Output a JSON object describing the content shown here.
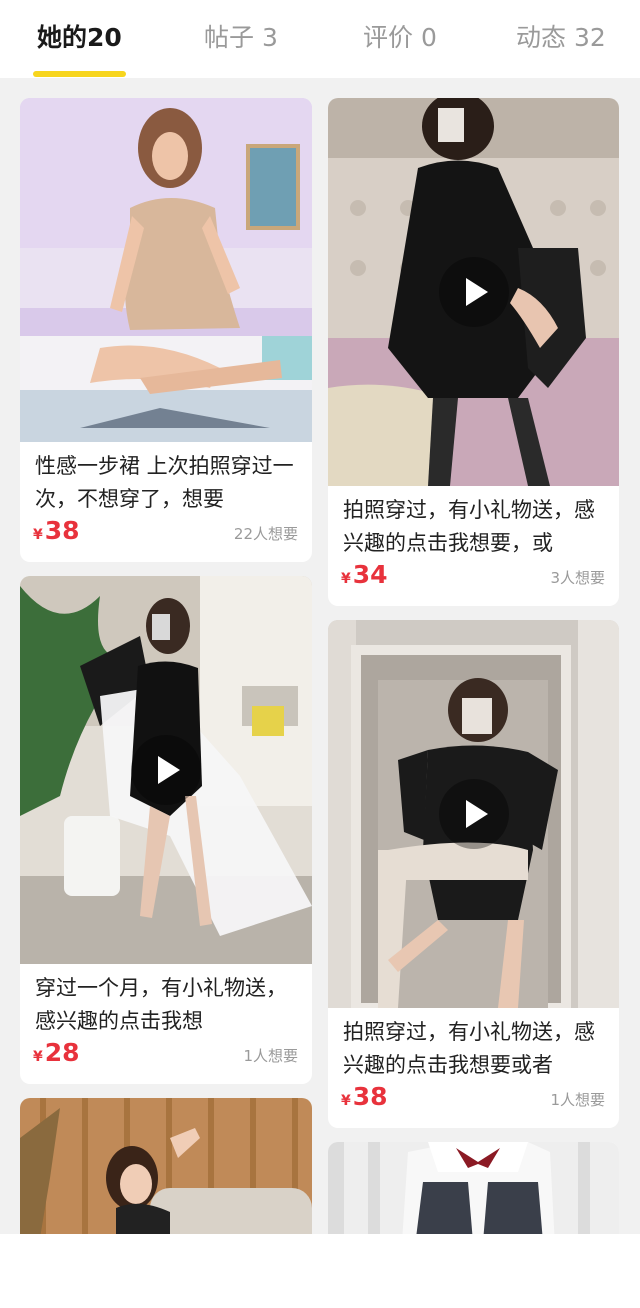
{
  "tabs": [
    {
      "label": "她的20",
      "active": true
    },
    {
      "label": "帖子 3",
      "active": false
    },
    {
      "label": "评价 0",
      "active": false
    },
    {
      "label": "动态 32",
      "active": false
    }
  ],
  "items": [
    {
      "title": "性感一步裙 上次拍照穿过一次，不想穿了，想要",
      "currency": "¥",
      "price": "38",
      "wants": "22人想要",
      "is_video": false
    },
    {
      "title": "拍照穿过，有小礼物送，感兴趣的点击我想要，或",
      "currency": "¥",
      "price": "34",
      "wants": "3人想要",
      "is_video": true
    },
    {
      "title": "穿过一个月，有小礼物送，感兴趣的点击我想",
      "currency": "¥",
      "price": "28",
      "wants": "1人想要",
      "is_video": true
    },
    {
      "title": "拍照穿过，有小礼物送，感兴趣的点击我想要或者",
      "currency": "¥",
      "price": "38",
      "wants": "1人想要",
      "is_video": true
    }
  ],
  "colors": {
    "accent_underline": "#f7d51d",
    "price": "#e8323c",
    "feed_background": "#f1f1f1"
  }
}
